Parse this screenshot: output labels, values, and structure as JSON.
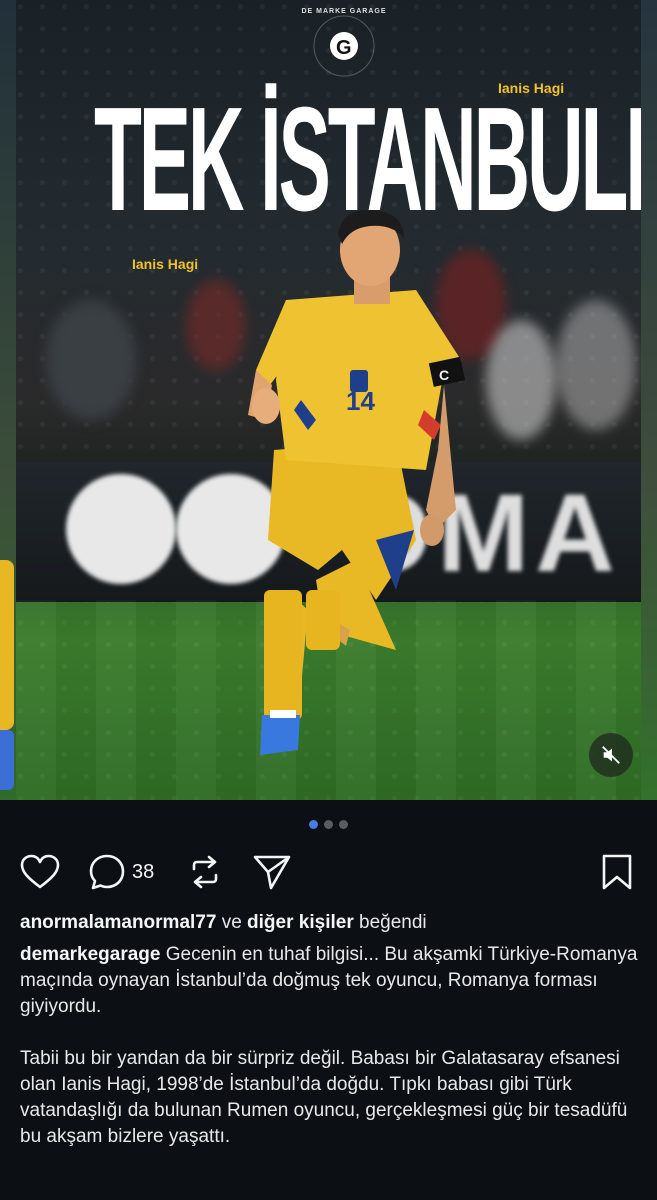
{
  "post": {
    "logo_letter": "G",
    "logo_ring_text": "DE MARKE GARAGE",
    "headline": "TEK İSTANBULLU",
    "tag_top": "Ianis Hagi",
    "tag_left": "Ianis Hagi",
    "jersey_number": "14",
    "banner_text": "OMA",
    "carousel_count": 3,
    "carousel_active_index": 0
  },
  "actions": {
    "comment_count": "38"
  },
  "likes": {
    "user": "anormalamanormal77",
    "connector": " ve ",
    "others": "diğer kişiler",
    "suffix": " beğendi"
  },
  "caption": {
    "username": "demarkegarage",
    "paragraph1": " Gecenin en tuhaf bilgisi... Bu akşamki Türkiye-Romanya maçında oynayan İstanbul’da doğmuş tek oyuncu, Romanya forması giyiyordu.",
    "paragraph2": "Tabii bu bir yandan da bir sürpriz değil. Babası bir Galatasaray efsanesi olan Ianis Hagi, 1998’de İstanbul’da doğdu. Tıpkı babası gibi Türk vatandaşlığı da bulunan Rumen oyuncu, gerçekleşmesi güç bir tesadüfü bu akşam bizlere yaşattı."
  },
  "colors": {
    "background": "#0c1014",
    "accent_dot": "#4a7be0",
    "tag_yellow": "#f3c12a",
    "jersey_yellow": "#e9b925"
  }
}
